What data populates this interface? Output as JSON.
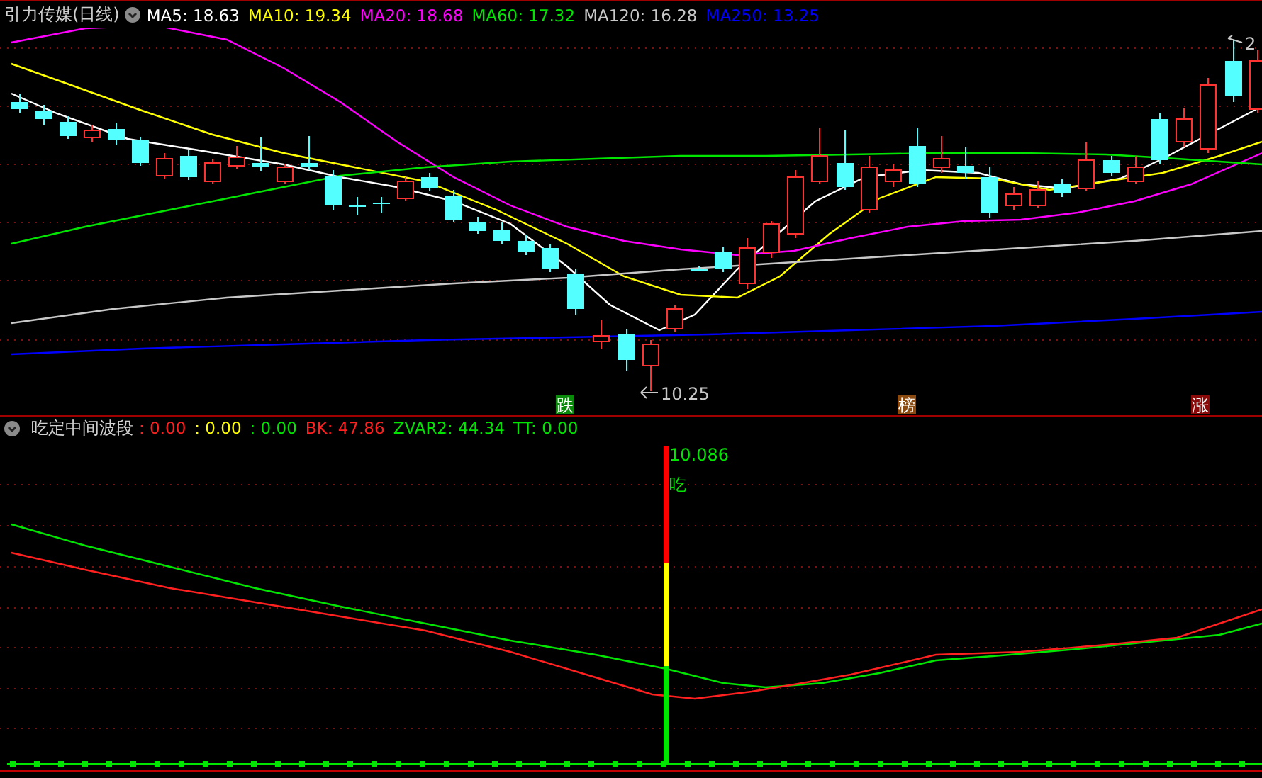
{
  "price_pane": {
    "title": "引力传媒(日线)",
    "indicators": [
      {
        "text": "MA5: 18.63",
        "color": "#ffffff"
      },
      {
        "text": "MA10: 19.34",
        "color": "#ffff00"
      },
      {
        "text": "MA20: 18.68",
        "color": "#ff00ff"
      },
      {
        "text": "MA60: 17.32",
        "color": "#00e600"
      },
      {
        "text": "MA120: 16.28",
        "color": "#c8c8c8"
      },
      {
        "text": "MA250: 13.25",
        "color": "#0000ff"
      }
    ],
    "annotations": [
      "10.25",
      "2"
    ],
    "markers": [
      {
        "text": "跌",
        "color": "#0a8a0a"
      },
      {
        "text": "榜",
        "color": "#8a4a10"
      },
      {
        "text": "涨",
        "color": "#8a0a0a"
      }
    ]
  },
  "indicator_pane": {
    "title": "吃定中间波段",
    "indicators": [
      {
        "text": ": 0.00",
        "color": "#ff2020"
      },
      {
        "text": ": 0.00",
        "color": "#ffff00"
      },
      {
        "text": ": 0.00",
        "color": "#00e600"
      },
      {
        "text": "BK: 47.86",
        "color": "#ff2020"
      },
      {
        "text": "ZVAR2: 44.34",
        "color": "#00e600"
      },
      {
        "text": "TT: 0.00",
        "color": "#00e600"
      }
    ],
    "signal_value": "10.086",
    "signal_label": "吃"
  }
}
